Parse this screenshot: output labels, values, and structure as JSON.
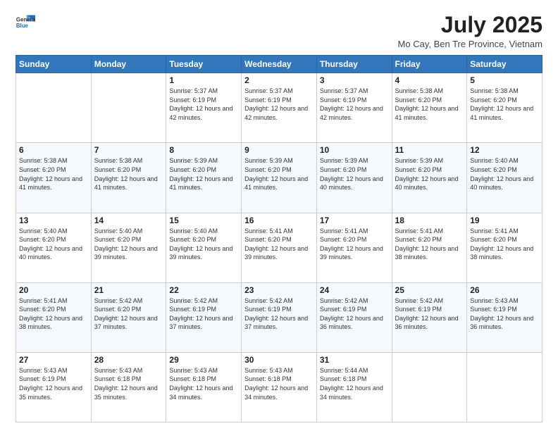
{
  "header": {
    "logo_line1": "General",
    "logo_line2": "Blue",
    "month_title": "July 2025",
    "location": "Mo Cay, Ben Tre Province, Vietnam"
  },
  "weekdays": [
    "Sunday",
    "Monday",
    "Tuesday",
    "Wednesday",
    "Thursday",
    "Friday",
    "Saturday"
  ],
  "weeks": [
    [
      {
        "day": "",
        "info": ""
      },
      {
        "day": "",
        "info": ""
      },
      {
        "day": "1",
        "info": "Sunrise: 5:37 AM\nSunset: 6:19 PM\nDaylight: 12 hours and 42 minutes."
      },
      {
        "day": "2",
        "info": "Sunrise: 5:37 AM\nSunset: 6:19 PM\nDaylight: 12 hours and 42 minutes."
      },
      {
        "day": "3",
        "info": "Sunrise: 5:37 AM\nSunset: 6:19 PM\nDaylight: 12 hours and 42 minutes."
      },
      {
        "day": "4",
        "info": "Sunrise: 5:38 AM\nSunset: 6:20 PM\nDaylight: 12 hours and 41 minutes."
      },
      {
        "day": "5",
        "info": "Sunrise: 5:38 AM\nSunset: 6:20 PM\nDaylight: 12 hours and 41 minutes."
      }
    ],
    [
      {
        "day": "6",
        "info": "Sunrise: 5:38 AM\nSunset: 6:20 PM\nDaylight: 12 hours and 41 minutes."
      },
      {
        "day": "7",
        "info": "Sunrise: 5:38 AM\nSunset: 6:20 PM\nDaylight: 12 hours and 41 minutes."
      },
      {
        "day": "8",
        "info": "Sunrise: 5:39 AM\nSunset: 6:20 PM\nDaylight: 12 hours and 41 minutes."
      },
      {
        "day": "9",
        "info": "Sunrise: 5:39 AM\nSunset: 6:20 PM\nDaylight: 12 hours and 41 minutes."
      },
      {
        "day": "10",
        "info": "Sunrise: 5:39 AM\nSunset: 6:20 PM\nDaylight: 12 hours and 40 minutes."
      },
      {
        "day": "11",
        "info": "Sunrise: 5:39 AM\nSunset: 6:20 PM\nDaylight: 12 hours and 40 minutes."
      },
      {
        "day": "12",
        "info": "Sunrise: 5:40 AM\nSunset: 6:20 PM\nDaylight: 12 hours and 40 minutes."
      }
    ],
    [
      {
        "day": "13",
        "info": "Sunrise: 5:40 AM\nSunset: 6:20 PM\nDaylight: 12 hours and 40 minutes."
      },
      {
        "day": "14",
        "info": "Sunrise: 5:40 AM\nSunset: 6:20 PM\nDaylight: 12 hours and 39 minutes."
      },
      {
        "day": "15",
        "info": "Sunrise: 5:40 AM\nSunset: 6:20 PM\nDaylight: 12 hours and 39 minutes."
      },
      {
        "day": "16",
        "info": "Sunrise: 5:41 AM\nSunset: 6:20 PM\nDaylight: 12 hours and 39 minutes."
      },
      {
        "day": "17",
        "info": "Sunrise: 5:41 AM\nSunset: 6:20 PM\nDaylight: 12 hours and 39 minutes."
      },
      {
        "day": "18",
        "info": "Sunrise: 5:41 AM\nSunset: 6:20 PM\nDaylight: 12 hours and 38 minutes."
      },
      {
        "day": "19",
        "info": "Sunrise: 5:41 AM\nSunset: 6:20 PM\nDaylight: 12 hours and 38 minutes."
      }
    ],
    [
      {
        "day": "20",
        "info": "Sunrise: 5:41 AM\nSunset: 6:20 PM\nDaylight: 12 hours and 38 minutes."
      },
      {
        "day": "21",
        "info": "Sunrise: 5:42 AM\nSunset: 6:20 PM\nDaylight: 12 hours and 37 minutes."
      },
      {
        "day": "22",
        "info": "Sunrise: 5:42 AM\nSunset: 6:19 PM\nDaylight: 12 hours and 37 minutes."
      },
      {
        "day": "23",
        "info": "Sunrise: 5:42 AM\nSunset: 6:19 PM\nDaylight: 12 hours and 37 minutes."
      },
      {
        "day": "24",
        "info": "Sunrise: 5:42 AM\nSunset: 6:19 PM\nDaylight: 12 hours and 36 minutes."
      },
      {
        "day": "25",
        "info": "Sunrise: 5:42 AM\nSunset: 6:19 PM\nDaylight: 12 hours and 36 minutes."
      },
      {
        "day": "26",
        "info": "Sunrise: 5:43 AM\nSunset: 6:19 PM\nDaylight: 12 hours and 36 minutes."
      }
    ],
    [
      {
        "day": "27",
        "info": "Sunrise: 5:43 AM\nSunset: 6:19 PM\nDaylight: 12 hours and 35 minutes."
      },
      {
        "day": "28",
        "info": "Sunrise: 5:43 AM\nSunset: 6:18 PM\nDaylight: 12 hours and 35 minutes."
      },
      {
        "day": "29",
        "info": "Sunrise: 5:43 AM\nSunset: 6:18 PM\nDaylight: 12 hours and 34 minutes."
      },
      {
        "day": "30",
        "info": "Sunrise: 5:43 AM\nSunset: 6:18 PM\nDaylight: 12 hours and 34 minutes."
      },
      {
        "day": "31",
        "info": "Sunrise: 5:44 AM\nSunset: 6:18 PM\nDaylight: 12 hours and 34 minutes."
      },
      {
        "day": "",
        "info": ""
      },
      {
        "day": "",
        "info": ""
      }
    ]
  ]
}
